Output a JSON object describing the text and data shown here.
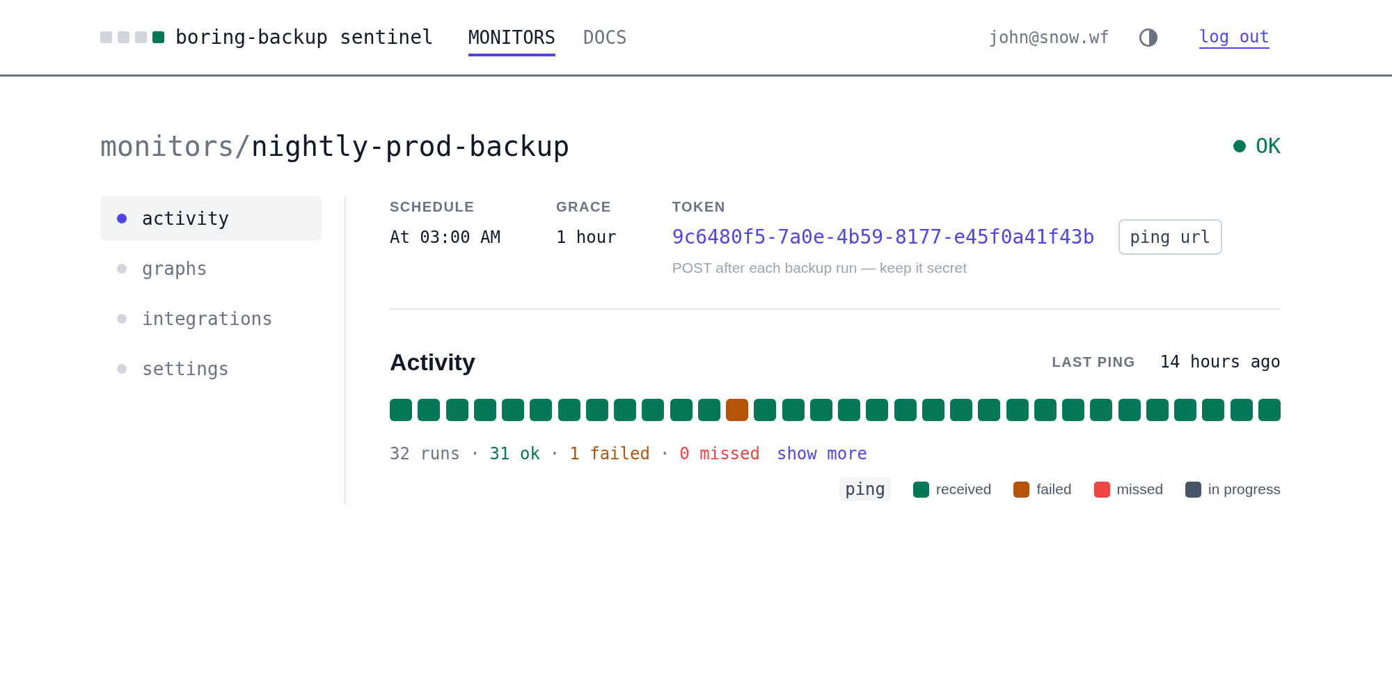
{
  "header": {
    "app_name": "boring-backup sentinel",
    "tabs": [
      {
        "label": "MONITORS",
        "selected": true
      },
      {
        "label": "DOCS",
        "selected": false
      }
    ],
    "user_email": "john@snow.wf",
    "logout": "log out"
  },
  "monitor": {
    "breadcrumb": "monitors/",
    "name": "nightly-prod-backup",
    "status": {
      "kind": "ok",
      "label": "OK"
    }
  },
  "sidebar": {
    "items": [
      {
        "label": "activity",
        "selected": true
      },
      {
        "label": "graphs",
        "selected": false
      },
      {
        "label": "integrations",
        "selected": false
      },
      {
        "label": "settings",
        "selected": false
      }
    ]
  },
  "details": {
    "fields": [
      {
        "label": "SCHEDULE",
        "value": "At 03:00 AM"
      },
      {
        "label": "GRACE",
        "value": "1 hour"
      }
    ],
    "token": {
      "label": "TOKEN",
      "value": "9c6480f5-7a0e-4b59-8177-e45f0a41f43b",
      "button": "ping url",
      "hint": "POST after each backup run — keep it secret"
    }
  },
  "activity": {
    "title": "Activity",
    "last_ping": {
      "label": "LAST PING",
      "value": "14 hours ago"
    },
    "runs": [
      {
        "kind": "received"
      },
      {
        "kind": "received"
      },
      {
        "kind": "received"
      },
      {
        "kind": "received"
      },
      {
        "kind": "received"
      },
      {
        "kind": "received"
      },
      {
        "kind": "received"
      },
      {
        "kind": "received"
      },
      {
        "kind": "received"
      },
      {
        "kind": "received"
      },
      {
        "kind": "received"
      },
      {
        "kind": "received"
      },
      {
        "kind": "failed"
      },
      {
        "kind": "received"
      },
      {
        "kind": "received"
      },
      {
        "kind": "received"
      },
      {
        "kind": "received"
      },
      {
        "kind": "received"
      },
      {
        "kind": "received"
      },
      {
        "kind": "received"
      },
      {
        "kind": "received"
      },
      {
        "kind": "received"
      },
      {
        "kind": "received"
      },
      {
        "kind": "received"
      },
      {
        "kind": "received"
      },
      {
        "kind": "received"
      },
      {
        "kind": "received"
      },
      {
        "kind": "received"
      },
      {
        "kind": "received"
      },
      {
        "kind": "received"
      },
      {
        "kind": "received"
      },
      {
        "kind": "received"
      }
    ],
    "summary": [
      {
        "kind": "total",
        "text": "32 runs"
      },
      {
        "kind": "separator",
        "text": "·"
      },
      {
        "kind": "ok",
        "text": "31 ok"
      },
      {
        "kind": "separator",
        "text": "·"
      },
      {
        "kind": "failed",
        "text": "1 failed"
      },
      {
        "kind": "separator",
        "text": "·"
      },
      {
        "kind": "missed",
        "text": "0 missed"
      }
    ],
    "show_more": "show more",
    "legend": {
      "tag": "ping",
      "items": [
        {
          "label": "received",
          "color": "#047857"
        },
        {
          "label": "failed",
          "color": "#b45309"
        },
        {
          "label": "missed",
          "color": "#ef4444"
        },
        {
          "label": "in progress",
          "color": "#475569"
        }
      ]
    }
  }
}
